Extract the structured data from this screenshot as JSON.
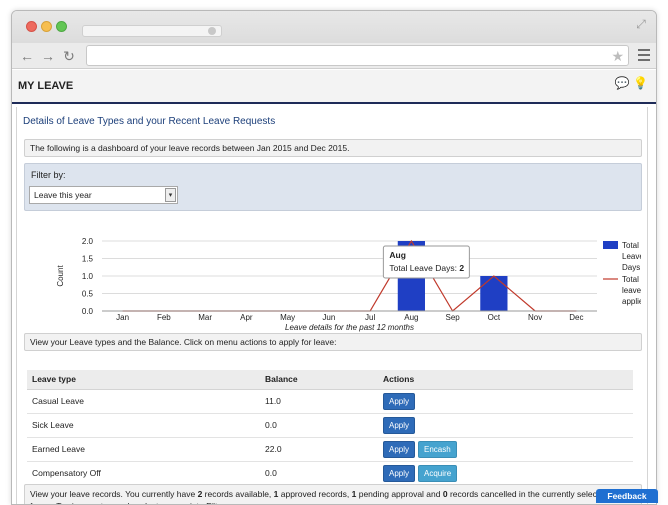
{
  "browser": {
    "controls": {
      "red": "#ee6a5e",
      "yellow": "#f6be4f",
      "green": "#62c654"
    },
    "nav": {
      "back": "←",
      "forward": "→",
      "reload": "↻"
    },
    "star": "★",
    "expand": "⤢"
  },
  "page": {
    "title": "MY LEAVE",
    "help_icons": "💬 💡"
  },
  "content": {
    "section_title": "Details of Leave Types and your Recent Leave Requests",
    "dashboard_info": "The following is a dashboard of your leave records between Jan 2015 and Dec 2015.",
    "filter": {
      "label": "Filter by:",
      "selected": "Leave this year"
    },
    "balance_info": "View your Leave types and the Balance. Click on menu actions to apply for leave:",
    "table": {
      "headers": [
        "Leave type",
        "Balance",
        "Actions"
      ],
      "rows": [
        {
          "type": "Casual Leave",
          "balance": "11.0",
          "actions": [
            "Apply"
          ]
        },
        {
          "type": "Sick Leave",
          "balance": "0.0",
          "actions": [
            "Apply"
          ]
        },
        {
          "type": "Earned Leave",
          "balance": "22.0",
          "actions": [
            "Apply",
            "Encash"
          ]
        },
        {
          "type": "Compensatory Off",
          "balance": "0.0",
          "actions": [
            "Apply",
            "Acquire"
          ]
        }
      ]
    },
    "records": {
      "prefix": "View your leave records. You currently have ",
      "available": "2",
      "mid1": " records available, ",
      "approved": "1",
      "mid2": " approved records, ",
      "pending": "1",
      "mid3": " pending approval and ",
      "cancelled": "0",
      "suffix": " records cancelled in the currently selected time frame. To view past records select appropriate Filters"
    },
    "feedback": "Feedback"
  },
  "chart_data": {
    "type": "bar",
    "categories": [
      "Jan",
      "Feb",
      "Mar",
      "Apr",
      "May",
      "Jun",
      "Jul",
      "Aug",
      "Sep",
      "Oct",
      "Nov",
      "Dec"
    ],
    "series": [
      {
        "name": "Total Leave Days",
        "type": "bar",
        "values": [
          0,
          0,
          0,
          0,
          0,
          0,
          0,
          2,
          0,
          1,
          0,
          0
        ]
      },
      {
        "name": "Total leave applied",
        "type": "line",
        "values": [
          0,
          0,
          0,
          0,
          0,
          0,
          0,
          2,
          0,
          1,
          0,
          0
        ]
      }
    ],
    "xlabel": "Leave details for the past 12 months",
    "ylabel": "Count",
    "ylim": [
      0,
      2
    ],
    "yticks": [
      "0.0",
      "0.5",
      "1.0",
      "1.5",
      "2.0"
    ],
    "grid": true,
    "legend": "right",
    "colors": {
      "bar": "#1f3fc4",
      "line": "#c0392b"
    },
    "tooltip": {
      "title": "Aug",
      "label": "Total Leave Days: ",
      "value": "2"
    }
  }
}
